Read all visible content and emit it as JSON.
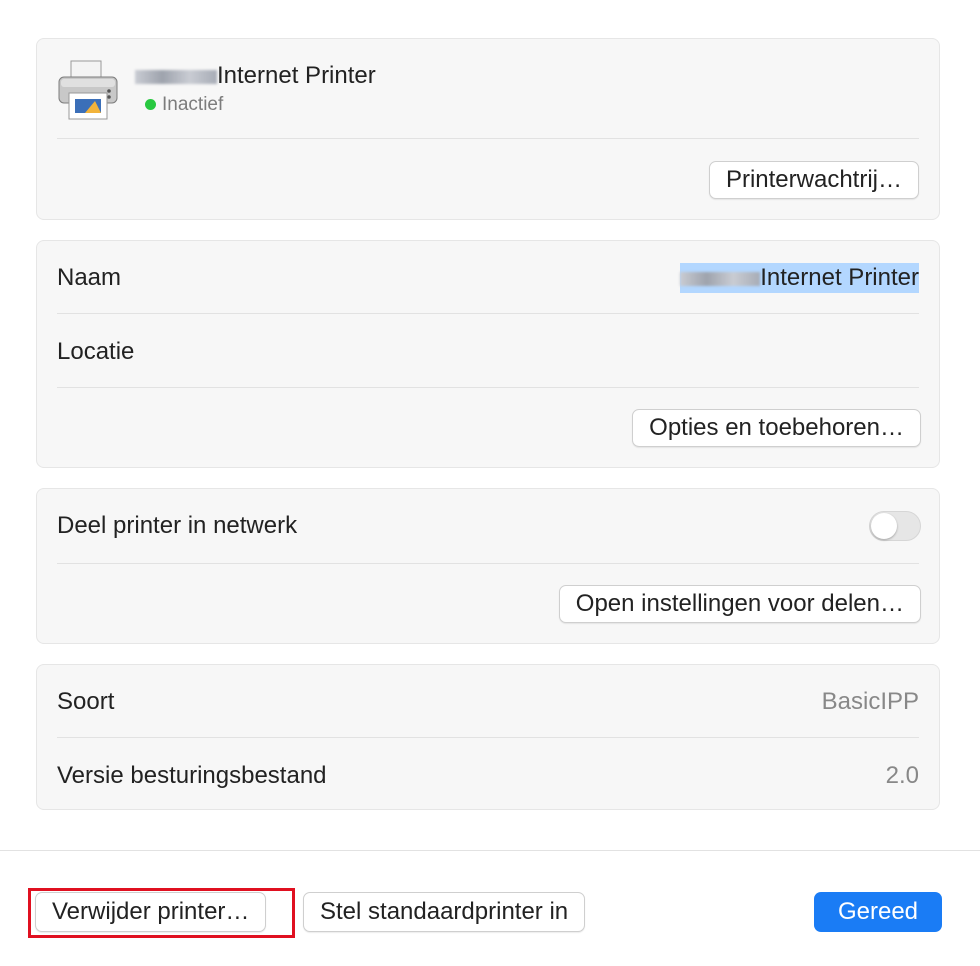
{
  "printer": {
    "name_suffix": "Internet Printer",
    "status": "Inactief",
    "queue_button": "Printerwachtrij…"
  },
  "details": {
    "name_label": "Naam",
    "name_value": "Internet Printer",
    "location_label": "Locatie",
    "options_button": "Opties en toebehoren…"
  },
  "sharing": {
    "share_label": "Deel printer in netwerk",
    "share_enabled": false,
    "open_sharing_button": "Open instellingen voor delen…"
  },
  "info": {
    "type_label": "Soort",
    "type_value": "BasicIPP",
    "driver_label": "Versie besturingsbestand",
    "driver_value": "2.0"
  },
  "footer": {
    "remove_button": "Verwijder printer…",
    "default_button": "Stel standaardprinter in",
    "done_button": "Gereed"
  },
  "colors": {
    "accent": "#1a7cf5",
    "status_green": "#28c840",
    "highlight_outline": "#e01020",
    "selection": "#b3d7ff"
  },
  "icons": {
    "printer": "printer-icon",
    "status": "status-dot-icon"
  }
}
